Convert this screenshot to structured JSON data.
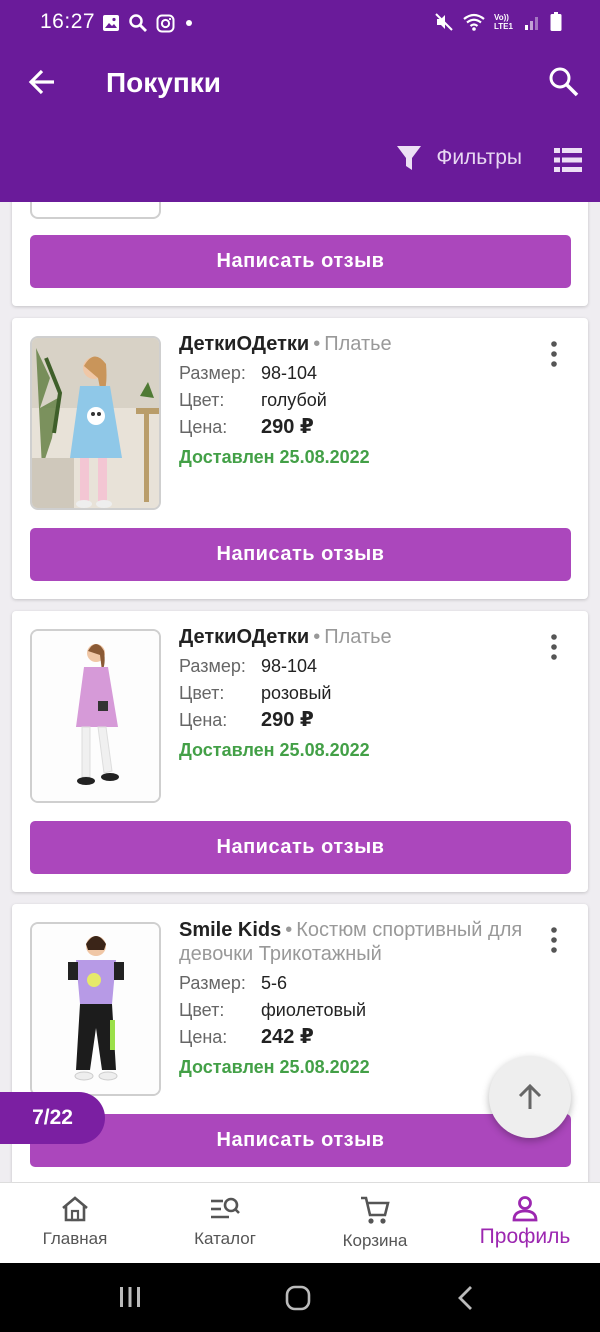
{
  "status_bar": {
    "time": "16:27",
    "left_icons": [
      "gallery-icon",
      "search-icon",
      "instagram-icon",
      "dot-icon"
    ],
    "right_icons": [
      "mute-icon",
      "wifi-icon",
      "volte-icon",
      "signal-icon",
      "battery-icon"
    ],
    "volte_label": "Vo)) LTE1"
  },
  "app_bar": {
    "title": "Покупки",
    "filters_label": "Фильтры"
  },
  "colors": {
    "primary": "#6a1b9a",
    "button": "#ab47bc",
    "delivered": "#43a047",
    "nav_active": "#9c27b0"
  },
  "labels": {
    "size": "Размер:",
    "color": "Цвет:",
    "price": "Цена:",
    "review_button": "Написать отзыв"
  },
  "items": [
    {
      "brand": "ДеткиОДетки",
      "category": "Платье",
      "size": "98-104",
      "color": "голубой",
      "price": "290 ₽",
      "status": "Доставлен 25.08.2022"
    },
    {
      "brand": "ДеткиОДетки",
      "category": "Платье",
      "size": "98-104",
      "color": "розовый",
      "price": "290 ₽",
      "status": "Доставлен 25.08.2022"
    },
    {
      "brand": "Smile Kids",
      "category": "Костюм спортивный для девочки Трикотажный",
      "size": "5-6",
      "color": "фиолетовый",
      "price": "242 ₽",
      "status": "Доставлен 25.08.2022"
    }
  ],
  "counter": "7/22",
  "bottom_nav": [
    {
      "label": "Главная",
      "icon": "home-icon",
      "active": false
    },
    {
      "label": "Каталог",
      "icon": "catalog-search-icon",
      "active": false
    },
    {
      "label": "Корзина",
      "icon": "cart-icon",
      "active": false
    },
    {
      "label": "Профиль",
      "icon": "profile-icon",
      "active": true
    }
  ]
}
